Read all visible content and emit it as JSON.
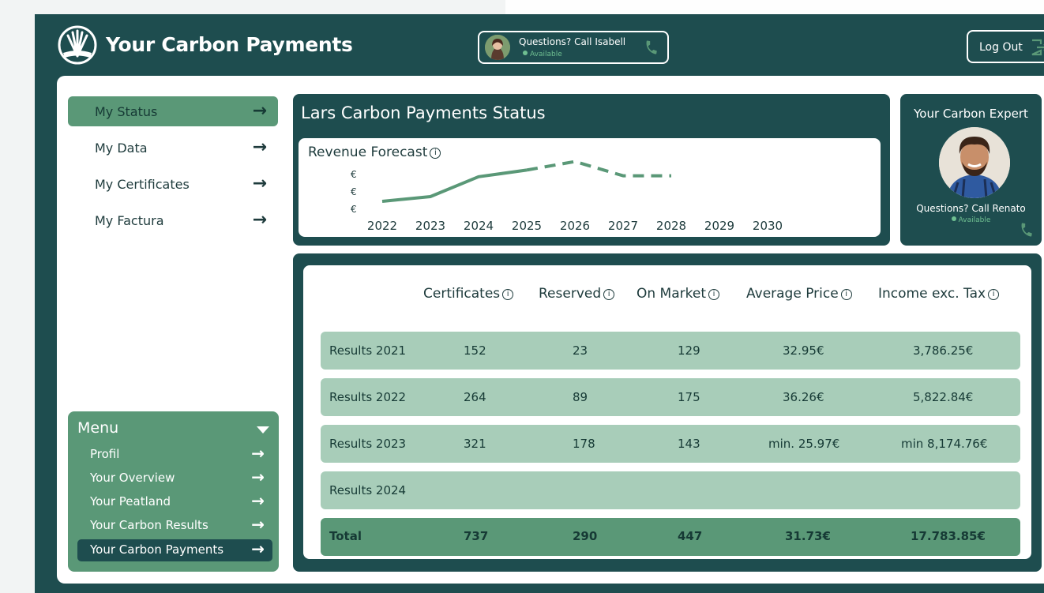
{
  "app": {
    "title": "Your Carbon Payments",
    "contact_pill": {
      "text": "Questions? Call Isabell",
      "status": "Available"
    },
    "logout_label": "Log Out"
  },
  "colors": {
    "dark_teal": "#1e4d4f",
    "accent_green": "#5a9877",
    "row_green": "#a8cdb9",
    "available_green": "#6fbf91"
  },
  "icons": {
    "logo": "leaf-fan-logo-icon",
    "phone": "phone-icon",
    "logout": "logout-icon",
    "arrow": "arrow-right-icon",
    "info": "info-icon",
    "caret": "caret-down-icon"
  },
  "nav": {
    "items": [
      {
        "label": "My Status",
        "active": true
      },
      {
        "label": "My Data",
        "active": false
      },
      {
        "label": "My Certificates",
        "active": false
      },
      {
        "label": "My Factura",
        "active": false
      }
    ]
  },
  "menu": {
    "title": "Menu",
    "items": [
      {
        "label": "Profil",
        "active": false
      },
      {
        "label": "Your Overview",
        "active": false
      },
      {
        "label": "Your Peatland",
        "active": false
      },
      {
        "label": "Your Carbon Results",
        "active": false
      },
      {
        "label": "Your Carbon Payments",
        "active": true
      }
    ]
  },
  "status": {
    "title": "Lars Carbon Payments Status",
    "chart_title": "Revenue Forecast",
    "chart_info": "i"
  },
  "chart_data": {
    "type": "line",
    "title": "Revenue Forecast",
    "x": [
      "2022",
      "2023",
      "2024",
      "2025",
      "2026",
      "2027",
      "2028",
      "2029",
      "2030"
    ],
    "ytick_labels": [
      "€",
      "€",
      "€"
    ],
    "series": [
      {
        "style": "solid",
        "values": [
          1.0,
          1.5,
          3.6,
          4.3,
          null,
          null,
          null,
          null,
          null
        ]
      },
      {
        "style": "dashed",
        "values": [
          null,
          null,
          null,
          4.3,
          5.2,
          3.7,
          3.7,
          null,
          null
        ]
      }
    ],
    "ylim": [
      0,
      6
    ],
    "grid": false,
    "xlabel": "",
    "ylabel": ""
  },
  "expert": {
    "title": "Your Carbon Expert",
    "call": "Questions? Call Renato",
    "status": "Available"
  },
  "table": {
    "headers": [
      "Certificates",
      "Reserved",
      "On Market",
      "Average Price",
      "Income exc. Tax"
    ],
    "rows": [
      {
        "label": "Results 2021",
        "values": [
          "152",
          "23",
          "129",
          "32.95€",
          "3,786.25€"
        ]
      },
      {
        "label": "Results 2022",
        "values": [
          "264",
          "89",
          "175",
          "36.26€",
          "5,822.84€"
        ]
      },
      {
        "label": "Results 2023",
        "values": [
          "321",
          "178",
          "143",
          "min. 25.97€",
          "min 8,174.76€"
        ]
      },
      {
        "label": "Results 2024",
        "values": [
          "",
          "",
          "",
          "",
          ""
        ]
      }
    ],
    "total": {
      "label": "Total",
      "values": [
        "737",
        "290",
        "447",
        "31.73€",
        "17.783.85€"
      ]
    }
  }
}
